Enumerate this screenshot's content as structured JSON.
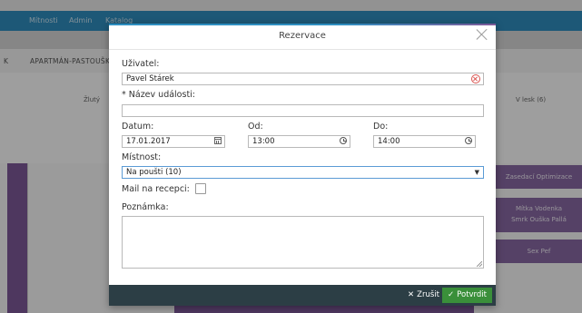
{
  "background": {
    "nav_items": [
      "Mítnosti",
      "Admin",
      "Katalog"
    ],
    "tab_label": "APARTMÁN-PASTOUŠKA",
    "col_left": "Žlutý",
    "col_right": "V lesk (6)",
    "right_cells": [
      "Zasedací Optimizace",
      "Mítka Vodenka",
      "Smrk Ouška Pallá",
      "Sex Pef"
    ]
  },
  "modal": {
    "title": "Rezervace",
    "user_label": "Uživatel:",
    "user_value": "Pavel Stárek",
    "event_label": "* Název události:",
    "event_value": "",
    "date_label": "Datum:",
    "date_value": "17.01.2017",
    "from_label": "Od:",
    "from_value": "13:00",
    "to_label": "Do:",
    "to_value": "14:00",
    "room_label": "Místnost:",
    "room_value": "Na poušti (10)",
    "mail_label": "Mail na recepci:",
    "mail_checked": false,
    "note_label": "Poznámka:",
    "note_value": ""
  },
  "footer": {
    "cancel_label": "Zrušit",
    "confirm_label": "Potvrdit"
  },
  "colors": {
    "nav": "#2f8fc1",
    "purple": "#7e5a99",
    "footer": "#2c3e45",
    "confirm": "#3a8f3a"
  }
}
